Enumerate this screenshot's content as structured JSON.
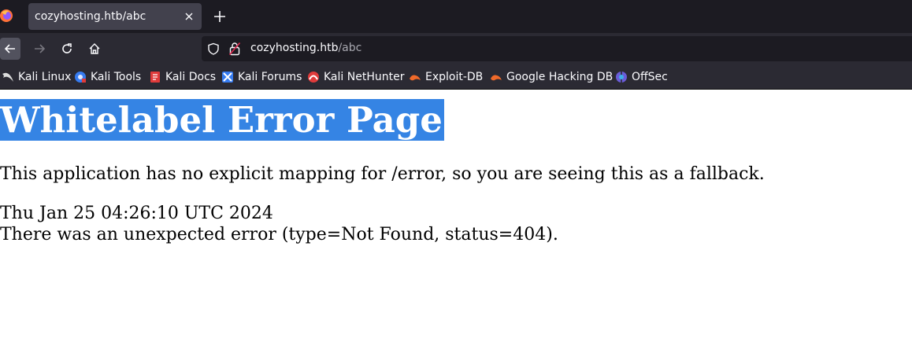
{
  "browser": {
    "tab": {
      "title": "cozyhosting.htb/abc"
    },
    "url": {
      "host": "cozyhosting.htb",
      "path": "/abc"
    },
    "bookmarks": [
      {
        "label": "Kali Linux",
        "icon": "kali-dragon-icon"
      },
      {
        "label": "Kali Tools",
        "icon": "kali-tools-icon"
      },
      {
        "label": "Kali Docs",
        "icon": "kali-docs-icon"
      },
      {
        "label": "Kali Forums",
        "icon": "kali-forums-icon"
      },
      {
        "label": "Kali NetHunter",
        "icon": "kali-nethunter-icon"
      },
      {
        "label": "Exploit-DB",
        "icon": "exploit-db-icon"
      },
      {
        "label": "Google Hacking DB",
        "icon": "google-hacking-db-icon"
      },
      {
        "label": "OffSec",
        "icon": "offsec-icon"
      }
    ]
  },
  "page": {
    "title": "Whitelabel Error Page",
    "message": "This application has no explicit mapping for /error, so you are seeing this as a fallback.",
    "timestamp": "Thu Jan 25 04:26:10 UTC 2024",
    "error": "There was an unexpected error (type=Not Found, status=404)."
  },
  "colors": {
    "tabstrip": "#1c1b22",
    "toolbar": "#2b2a33",
    "selection": "#3584e4"
  }
}
